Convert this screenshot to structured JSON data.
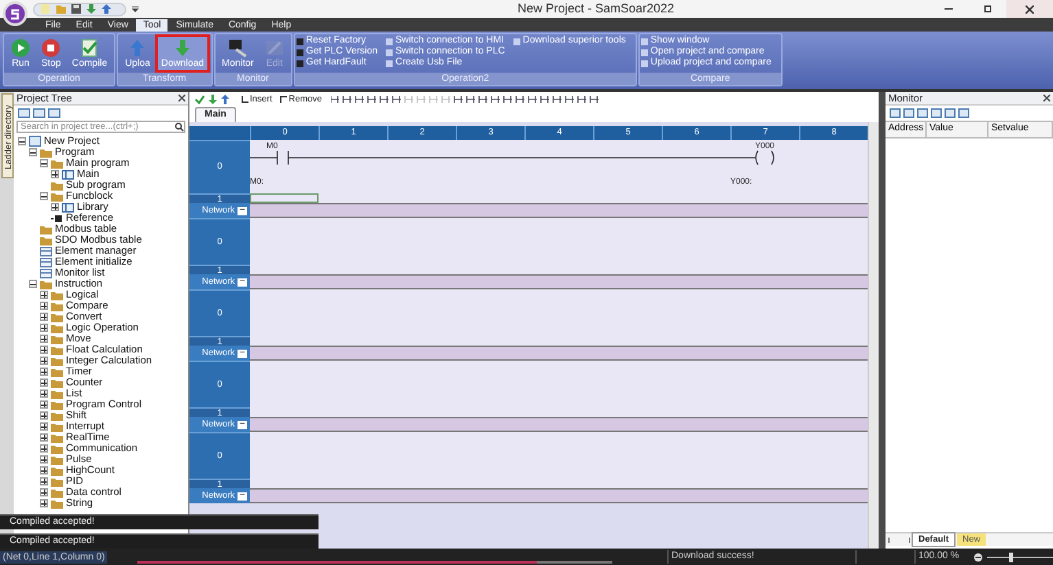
{
  "window": {
    "title": "New Project - SamSoar2022"
  },
  "menu": [
    {
      "label": "File",
      "selected": false
    },
    {
      "label": "Edit",
      "selected": false
    },
    {
      "label": "View",
      "selected": false
    },
    {
      "label": "Tool",
      "selected": true
    },
    {
      "label": "Simulate",
      "selected": false
    },
    {
      "label": "Config",
      "selected": false
    },
    {
      "label": "Help",
      "selected": false
    }
  ],
  "ribbon": {
    "groups": [
      {
        "label": "Operation",
        "kind": "buttons",
        "buttons": [
          {
            "label": "Run",
            "highlighted": false,
            "disabled": false
          },
          {
            "label": "Stop",
            "highlighted": false,
            "disabled": false
          },
          {
            "label": "Compile",
            "highlighted": false,
            "disabled": false
          }
        ]
      },
      {
        "label": "Transform",
        "kind": "buttons",
        "buttons": [
          {
            "label": "Uploa",
            "highlighted": false,
            "disabled": false
          },
          {
            "label": "Download",
            "highlighted": true,
            "disabled": false
          }
        ]
      },
      {
        "label": "Monitor",
        "kind": "buttons",
        "buttons": [
          {
            "label": "Monitor",
            "highlighted": false,
            "disabled": false
          },
          {
            "label": "Edit",
            "highlighted": false,
            "disabled": true
          }
        ]
      },
      {
        "label": "Operation2",
        "kind": "list",
        "columns": [
          [
            "Reset Factory",
            "Get PLC Version",
            "Get HardFault"
          ],
          [
            "Switch connection to HMI",
            "Switch connection to PLC",
            "Create Usb File"
          ],
          [
            "Download superior tools"
          ]
        ]
      },
      {
        "label": "Compare",
        "kind": "list",
        "columns": [
          [
            "Show window",
            "Open project and compare",
            "Upload project and compare"
          ]
        ]
      }
    ]
  },
  "ladder_directory": {
    "label": "Ladder directory"
  },
  "project_tree": {
    "title": "Project Tree",
    "search": {
      "placeholder": "Search in project tree...(ctrl+;)"
    },
    "items": [
      {
        "label": "New Project",
        "kind": "project",
        "expanded": true,
        "children": [
          {
            "label": "Program",
            "kind": "folder",
            "expanded": true,
            "children": [
              {
                "label": "Main program",
                "kind": "folder",
                "expanded": true,
                "children": [
                  {
                    "label": "Main",
                    "kind": "program",
                    "expanded": false
                  }
                ]
              },
              {
                "label": "Sub program",
                "kind": "folder"
              },
              {
                "label": "Funcblock",
                "kind": "folder",
                "expanded": true,
                "children": [
                  {
                    "label": "Library",
                    "kind": "program",
                    "expanded": false
                  }
                ]
              },
              {
                "label": "Reference",
                "kind": "reference"
              }
            ]
          },
          {
            "label": "Modbus table",
            "kind": "folder"
          },
          {
            "label": "SDO Modbus table",
            "kind": "folder"
          },
          {
            "label": "Element manager",
            "kind": "table"
          },
          {
            "label": "Element initialize",
            "kind": "table"
          },
          {
            "label": "Monitor list",
            "kind": "table"
          },
          {
            "label": "Instruction",
            "kind": "folder",
            "expanded": true,
            "children": [
              {
                "label": "Logical",
                "kind": "folder",
                "expanded": false
              },
              {
                "label": "Compare",
                "kind": "folder",
                "expanded": false
              },
              {
                "label": "Convert",
                "kind": "folder",
                "expanded": false
              },
              {
                "label": "Logic Operation",
                "kind": "folder",
                "expanded": false
              },
              {
                "label": "Move",
                "kind": "folder",
                "expanded": false
              },
              {
                "label": "Float Calculation",
                "kind": "folder",
                "expanded": false
              },
              {
                "label": "Integer Calculation",
                "kind": "folder",
                "expanded": false
              },
              {
                "label": "Timer",
                "kind": "folder",
                "expanded": false
              },
              {
                "label": "Counter",
                "kind": "folder",
                "expanded": false
              },
              {
                "label": "List",
                "kind": "folder",
                "expanded": false
              },
              {
                "label": "Program Control",
                "kind": "folder",
                "expanded": false
              },
              {
                "label": "Shift",
                "kind": "folder",
                "expanded": false
              },
              {
                "label": "Interrupt",
                "kind": "folder",
                "expanded": false
              },
              {
                "label": "RealTime",
                "kind": "folder",
                "expanded": false
              },
              {
                "label": "Communication",
                "kind": "folder",
                "expanded": false
              },
              {
                "label": "Pulse",
                "kind": "folder",
                "expanded": false
              },
              {
                "label": "HighCount",
                "kind": "folder",
                "expanded": false
              },
              {
                "label": "PID",
                "kind": "folder",
                "expanded": false
              },
              {
                "label": "Data control",
                "kind": "folder",
                "expanded": false
              },
              {
                "label": "String",
                "kind": "folder",
                "expanded": false
              }
            ]
          }
        ]
      }
    ]
  },
  "editor": {
    "toolbar": {
      "insert": "Insert",
      "remove": "Remove"
    },
    "tabs": [
      {
        "label": "Main",
        "selected": true
      }
    ],
    "columns": [
      "0",
      "1",
      "2",
      "3",
      "4",
      "5",
      "6",
      "7",
      "8"
    ],
    "networks": [
      {
        "rows": [
          {
            "label": "0",
            "kind": "rung",
            "contact": {
              "name": "M0",
              "comment": "M0:"
            },
            "coil": {
              "name": "Y000",
              "comment": "Y000:"
            }
          },
          {
            "label": "1",
            "kind": "gap",
            "cursor": true
          }
        ]
      },
      {
        "header": "Network",
        "collapse": "−",
        "rows": [
          {
            "label": "0",
            "kind": "rung"
          },
          {
            "label": "1",
            "kind": "gap"
          }
        ]
      },
      {
        "header": "Network",
        "collapse": "−",
        "rows": [
          {
            "label": "0",
            "kind": "rung"
          },
          {
            "label": "1",
            "kind": "gap"
          }
        ]
      },
      {
        "header": "Network",
        "collapse": "−",
        "rows": [
          {
            "label": "0",
            "kind": "rung"
          },
          {
            "label": "1",
            "kind": "gap"
          }
        ]
      },
      {
        "header": "Network",
        "collapse": "−",
        "rows": [
          {
            "label": "0",
            "kind": "rung"
          },
          {
            "label": "1",
            "kind": "gap"
          }
        ]
      },
      {
        "header": "Network",
        "collapse": "−"
      }
    ]
  },
  "monitor": {
    "title": "Monitor",
    "columns": [
      "Address",
      "Value",
      "Setvalue"
    ],
    "sheets": [
      {
        "label": "Default",
        "selected": true
      },
      {
        "label": "New",
        "selected": false
      }
    ]
  },
  "messages": [
    "Compiled accepted!",
    "Compiled accepted!"
  ],
  "status_bar": {
    "position": "(Net 0,Line 1,Column 0)",
    "progress": {
      "level": 0.84
    },
    "message": "Download success!",
    "zoom": "100.00 %",
    "zoom_slider": {
      "level": 0.35
    }
  }
}
